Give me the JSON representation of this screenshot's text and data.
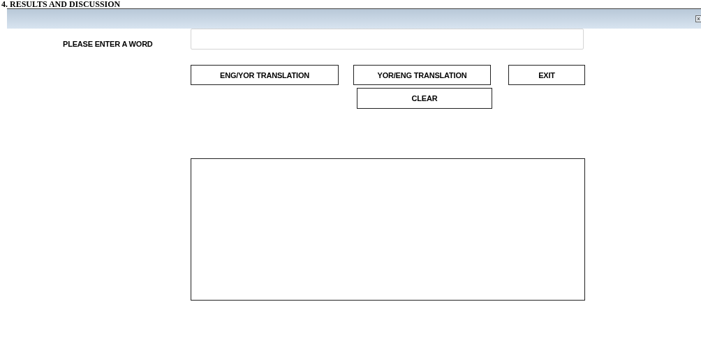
{
  "heading": "4. RESULTS AND DISCUSSION",
  "form": {
    "label": "PLEASE ENTER A WORD"
  },
  "buttons": [
    {
      "label": "ENG/YOR TRANSLATION",
      "kind": "main"
    },
    {
      "label": "YOR/ENG TRANSLATION",
      "kind": "main"
    },
    {
      "label": "EXIT",
      "kind": "main"
    },
    {
      "label": "CLEAR",
      "kind": "second"
    }
  ]
}
